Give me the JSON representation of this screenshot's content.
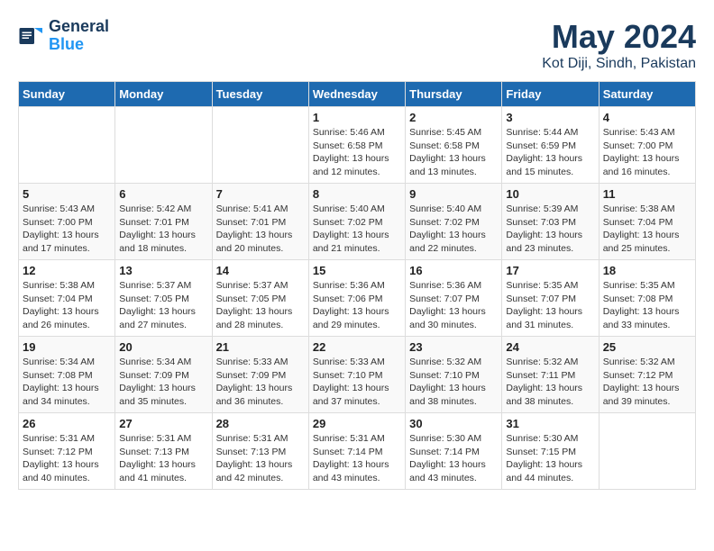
{
  "header": {
    "logo_general": "General",
    "logo_blue": "Blue",
    "month": "May 2024",
    "location": "Kot Diji, Sindh, Pakistan"
  },
  "days_of_week": [
    "Sunday",
    "Monday",
    "Tuesday",
    "Wednesday",
    "Thursday",
    "Friday",
    "Saturday"
  ],
  "weeks": [
    [
      {
        "day": "",
        "info": ""
      },
      {
        "day": "",
        "info": ""
      },
      {
        "day": "",
        "info": ""
      },
      {
        "day": "1",
        "sunrise": "5:46 AM",
        "sunset": "6:58 PM",
        "daylight": "13 hours and 12 minutes."
      },
      {
        "day": "2",
        "sunrise": "5:45 AM",
        "sunset": "6:58 PM",
        "daylight": "13 hours and 13 minutes."
      },
      {
        "day": "3",
        "sunrise": "5:44 AM",
        "sunset": "6:59 PM",
        "daylight": "13 hours and 15 minutes."
      },
      {
        "day": "4",
        "sunrise": "5:43 AM",
        "sunset": "7:00 PM",
        "daylight": "13 hours and 16 minutes."
      }
    ],
    [
      {
        "day": "5",
        "sunrise": "5:43 AM",
        "sunset": "7:00 PM",
        "daylight": "13 hours and 17 minutes."
      },
      {
        "day": "6",
        "sunrise": "5:42 AM",
        "sunset": "7:01 PM",
        "daylight": "13 hours and 18 minutes."
      },
      {
        "day": "7",
        "sunrise": "5:41 AM",
        "sunset": "7:01 PM",
        "daylight": "13 hours and 20 minutes."
      },
      {
        "day": "8",
        "sunrise": "5:40 AM",
        "sunset": "7:02 PM",
        "daylight": "13 hours and 21 minutes."
      },
      {
        "day": "9",
        "sunrise": "5:40 AM",
        "sunset": "7:02 PM",
        "daylight": "13 hours and 22 minutes."
      },
      {
        "day": "10",
        "sunrise": "5:39 AM",
        "sunset": "7:03 PM",
        "daylight": "13 hours and 23 minutes."
      },
      {
        "day": "11",
        "sunrise": "5:38 AM",
        "sunset": "7:04 PM",
        "daylight": "13 hours and 25 minutes."
      }
    ],
    [
      {
        "day": "12",
        "sunrise": "5:38 AM",
        "sunset": "7:04 PM",
        "daylight": "13 hours and 26 minutes."
      },
      {
        "day": "13",
        "sunrise": "5:37 AM",
        "sunset": "7:05 PM",
        "daylight": "13 hours and 27 minutes."
      },
      {
        "day": "14",
        "sunrise": "5:37 AM",
        "sunset": "7:05 PM",
        "daylight": "13 hours and 28 minutes."
      },
      {
        "day": "15",
        "sunrise": "5:36 AM",
        "sunset": "7:06 PM",
        "daylight": "13 hours and 29 minutes."
      },
      {
        "day": "16",
        "sunrise": "5:36 AM",
        "sunset": "7:07 PM",
        "daylight": "13 hours and 30 minutes."
      },
      {
        "day": "17",
        "sunrise": "5:35 AM",
        "sunset": "7:07 PM",
        "daylight": "13 hours and 31 minutes."
      },
      {
        "day": "18",
        "sunrise": "5:35 AM",
        "sunset": "7:08 PM",
        "daylight": "13 hours and 33 minutes."
      }
    ],
    [
      {
        "day": "19",
        "sunrise": "5:34 AM",
        "sunset": "7:08 PM",
        "daylight": "13 hours and 34 minutes."
      },
      {
        "day": "20",
        "sunrise": "5:34 AM",
        "sunset": "7:09 PM",
        "daylight": "13 hours and 35 minutes."
      },
      {
        "day": "21",
        "sunrise": "5:33 AM",
        "sunset": "7:09 PM",
        "daylight": "13 hours and 36 minutes."
      },
      {
        "day": "22",
        "sunrise": "5:33 AM",
        "sunset": "7:10 PM",
        "daylight": "13 hours and 37 minutes."
      },
      {
        "day": "23",
        "sunrise": "5:32 AM",
        "sunset": "7:10 PM",
        "daylight": "13 hours and 38 minutes."
      },
      {
        "day": "24",
        "sunrise": "5:32 AM",
        "sunset": "7:11 PM",
        "daylight": "13 hours and 38 minutes."
      },
      {
        "day": "25",
        "sunrise": "5:32 AM",
        "sunset": "7:12 PM",
        "daylight": "13 hours and 39 minutes."
      }
    ],
    [
      {
        "day": "26",
        "sunrise": "5:31 AM",
        "sunset": "7:12 PM",
        "daylight": "13 hours and 40 minutes."
      },
      {
        "day": "27",
        "sunrise": "5:31 AM",
        "sunset": "7:13 PM",
        "daylight": "13 hours and 41 minutes."
      },
      {
        "day": "28",
        "sunrise": "5:31 AM",
        "sunset": "7:13 PM",
        "daylight": "13 hours and 42 minutes."
      },
      {
        "day": "29",
        "sunrise": "5:31 AM",
        "sunset": "7:14 PM",
        "daylight": "13 hours and 43 minutes."
      },
      {
        "day": "30",
        "sunrise": "5:30 AM",
        "sunset": "7:14 PM",
        "daylight": "13 hours and 43 minutes."
      },
      {
        "day": "31",
        "sunrise": "5:30 AM",
        "sunset": "7:15 PM",
        "daylight": "13 hours and 44 minutes."
      },
      {
        "day": "",
        "info": ""
      }
    ]
  ],
  "labels": {
    "sunrise": "Sunrise:",
    "sunset": "Sunset:",
    "daylight": "Daylight hours"
  }
}
